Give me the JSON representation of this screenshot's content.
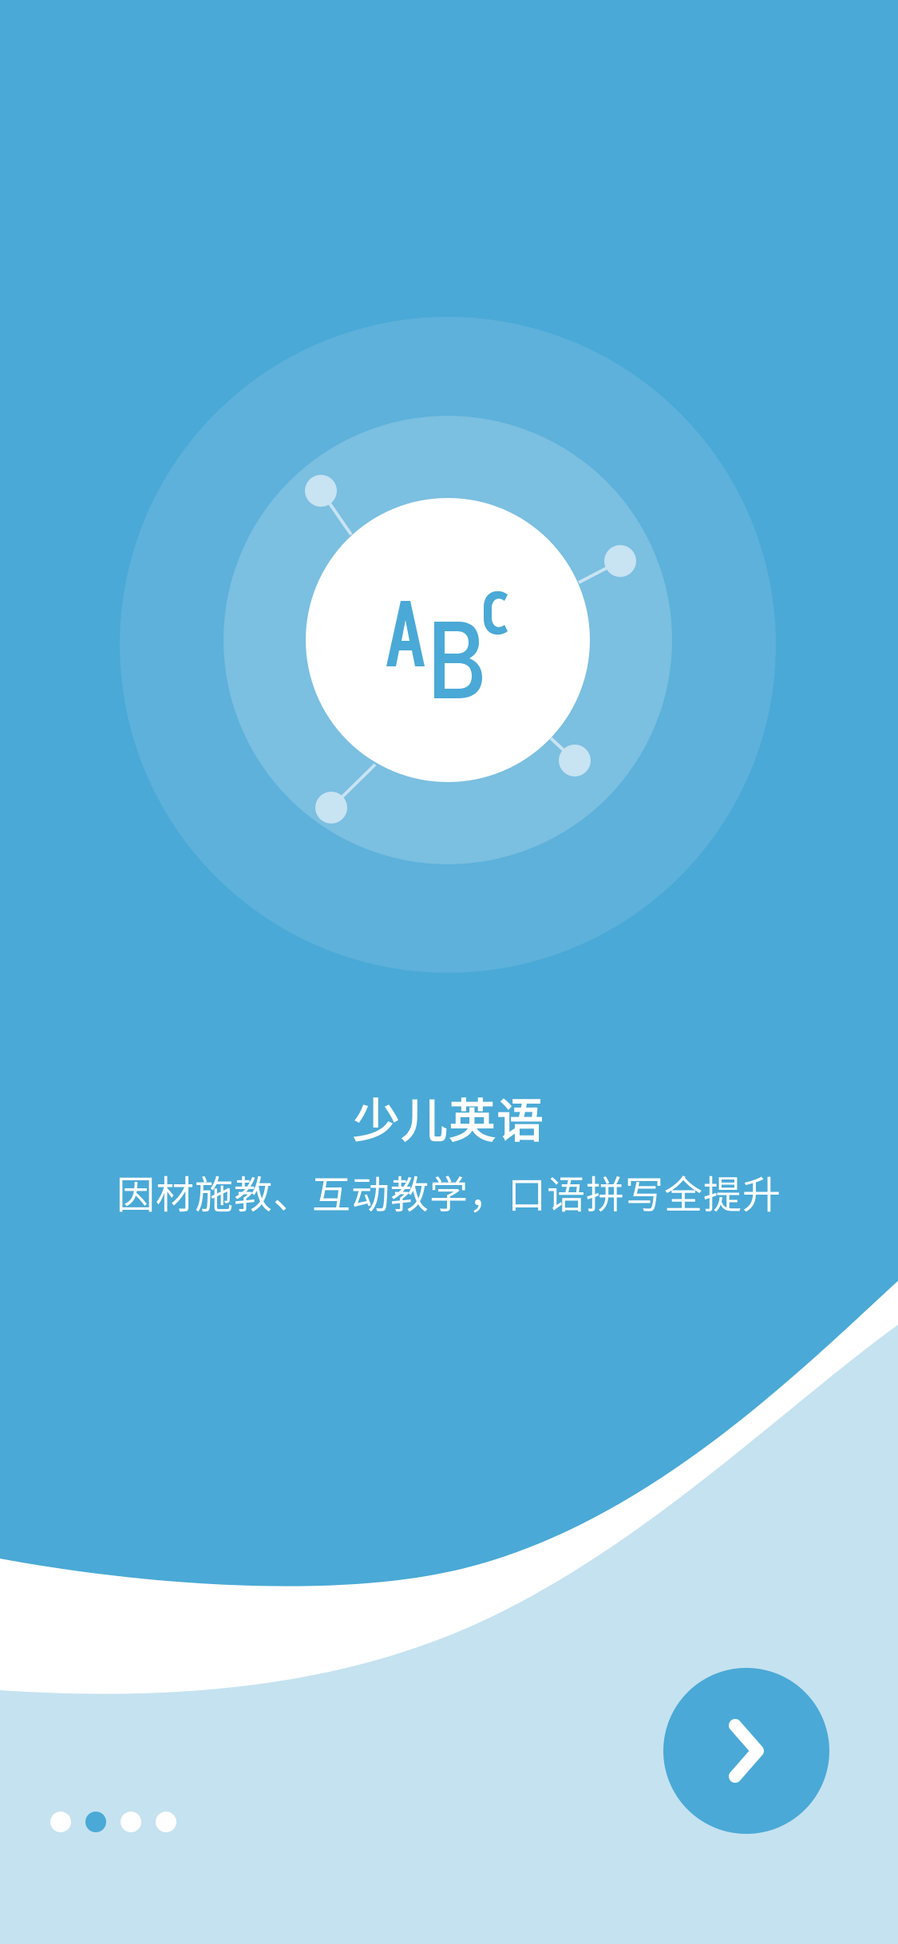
{
  "colors": {
    "primary": "#4aa9d6",
    "outer_ring": "#5db1da",
    "inner_ring": "#7bbfe1",
    "node": "#c8e3f1",
    "light_bg": "#c5e2f0",
    "white": "#ffffff"
  },
  "illustration": {
    "letters": [
      "A",
      "B",
      "C"
    ],
    "icon": "abc-letters-icon"
  },
  "onboarding": {
    "title": "少儿英语",
    "subtitle": "因材施教、互动教学，口语拼写全提升"
  },
  "pager": {
    "total": 4,
    "current": 2
  },
  "next_button": {
    "icon": "chevron-right-icon"
  }
}
